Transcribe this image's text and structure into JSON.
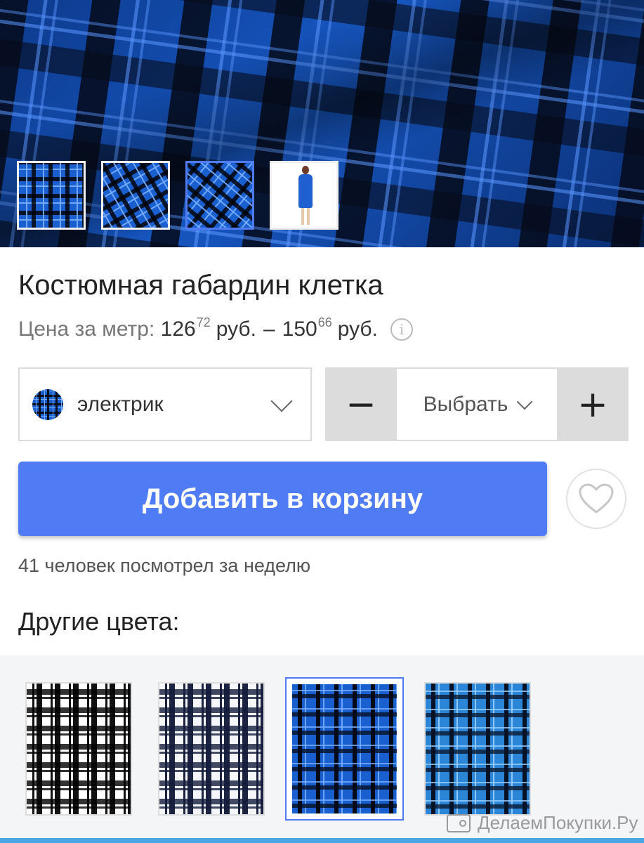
{
  "product": {
    "title": "Костюмная габардин клетка",
    "price_label": "Цена за метр:",
    "price_from_int": "126",
    "price_from_dec": "72",
    "price_to_int": "150",
    "price_to_dec": "66",
    "currency": "руб.",
    "dash": "–"
  },
  "gallery": {
    "thumbnails": [
      "plaid-flat",
      "plaid-folded",
      "plaid-angled",
      "model-dress"
    ],
    "selected_index": 2
  },
  "color_select": {
    "value": "электрик"
  },
  "quantity": {
    "value": "Выбрать",
    "minus": "−",
    "plus": "+"
  },
  "actions": {
    "add_to_cart": "Добавить в корзину"
  },
  "stats": {
    "views": "41 человек посмотрел за неделю"
  },
  "other_colors": {
    "title": "Другие цвета:",
    "selected_index": 2
  },
  "watermark": {
    "text": "ДелаемПокупки.Ру"
  },
  "colors": {
    "accent": "#4f7bf5",
    "bottom_bar": "#4aa6e0"
  }
}
